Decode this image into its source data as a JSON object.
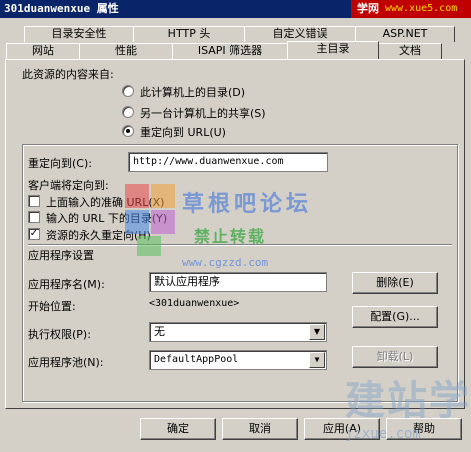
{
  "window": {
    "title": "301duanwenxue 属性"
  },
  "site_watermark": {
    "name": "学网",
    "url": "www.xue5.com"
  },
  "tabs_row1": [
    "目录安全性",
    "HTTP 头",
    "自定义错误",
    "ASP.NET"
  ],
  "tabs_row2": [
    "网站",
    "性能",
    "ISAPI 筛选器",
    "主目录",
    "文档"
  ],
  "active_tab": "主目录",
  "content_source": {
    "label": "此资源的内容来自:",
    "options": [
      {
        "label": "此计算机上的目录(D)",
        "selected": false
      },
      {
        "label": "另一台计算机上的共享(S)",
        "selected": false
      },
      {
        "label": "重定向到 URL(U)",
        "selected": true
      }
    ]
  },
  "redirect": {
    "label": "重定向到(C):",
    "value": "http://www.duanwenxue.com",
    "client_label": "客户端将定向到:",
    "checks": [
      {
        "label": "上面输入的准确 URL(X)",
        "checked": false
      },
      {
        "label": "输入的 URL 下的目录(Y)",
        "checked": false
      },
      {
        "label": "资源的永久重定向(H)",
        "checked": true
      }
    ]
  },
  "app_settings": {
    "label": "应用程序设置",
    "name_label": "应用程序名(M):",
    "name_value": "默认应用程序",
    "delete_btn": "删除(E)",
    "start_label": "开始位置:",
    "start_value": "<301duanwenxue>",
    "config_btn": "配置(G)...",
    "perm_label": "执行权限(P):",
    "perm_value": "无",
    "pool_label": "应用程序池(N):",
    "pool_value": "DefaultAppPool",
    "unload_btn": "卸载(L)"
  },
  "footer": {
    "ok": "确定",
    "cancel": "取消",
    "apply": "应用(A)",
    "help": "帮助"
  },
  "overlays": {
    "forum": "草根吧论坛",
    "ban": "禁止转载",
    "forum_url": "www.cgzzd.com",
    "brand": "建站学",
    "brand_url": "jzxue.com"
  }
}
